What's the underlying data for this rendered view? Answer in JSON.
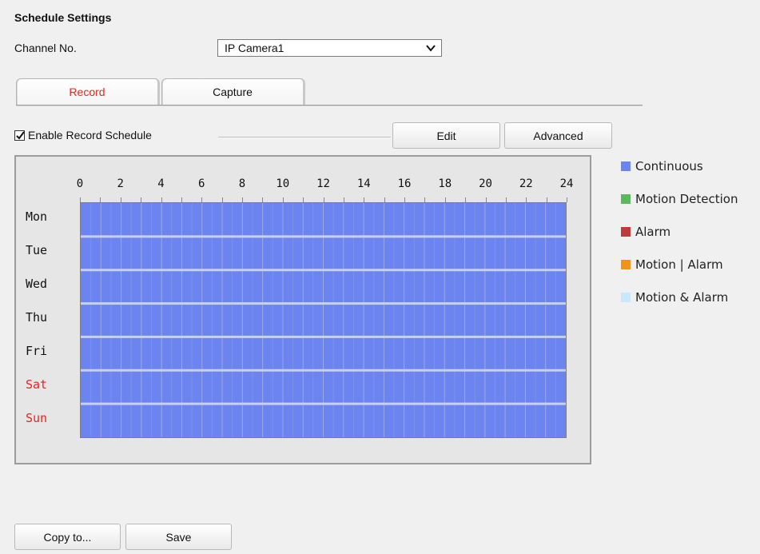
{
  "title": "Schedule Settings",
  "channel": {
    "label": "Channel No.",
    "selected": "IP Camera1"
  },
  "tabs": [
    {
      "label": "Record",
      "active": true
    },
    {
      "label": "Capture",
      "active": false
    }
  ],
  "enable_schedule": {
    "label": "Enable Record Schedule",
    "checked": true
  },
  "buttons": {
    "edit": "Edit",
    "advanced": "Advanced",
    "copy": "Copy to...",
    "save": "Save"
  },
  "hours": [
    "0",
    "2",
    "4",
    "6",
    "8",
    "10",
    "12",
    "14",
    "16",
    "18",
    "20",
    "22",
    "24"
  ],
  "days": [
    {
      "label": "Mon",
      "color": "#111111"
    },
    {
      "label": "Tue",
      "color": "#111111"
    },
    {
      "label": "Wed",
      "color": "#111111"
    },
    {
      "label": "Thu",
      "color": "#111111"
    },
    {
      "label": "Fri",
      "color": "#111111"
    },
    {
      "label": "Sat",
      "color": "#e4271f"
    },
    {
      "label": "Sun",
      "color": "#e4271f"
    }
  ],
  "legend": [
    {
      "label": "Continuous",
      "color": "#6b84f0"
    },
    {
      "label": "Motion Detection",
      "color": "#5cb85c"
    },
    {
      "label": "Alarm",
      "color": "#c0393b"
    },
    {
      "label": "Motion | Alarm",
      "color": "#f0931d"
    },
    {
      "label": "Motion & Alarm",
      "color": "#c9e8fa"
    }
  ],
  "schedule": {
    "mode": "Continuous",
    "fill_color": "#6b84f0",
    "all_day_every_day": true
  }
}
